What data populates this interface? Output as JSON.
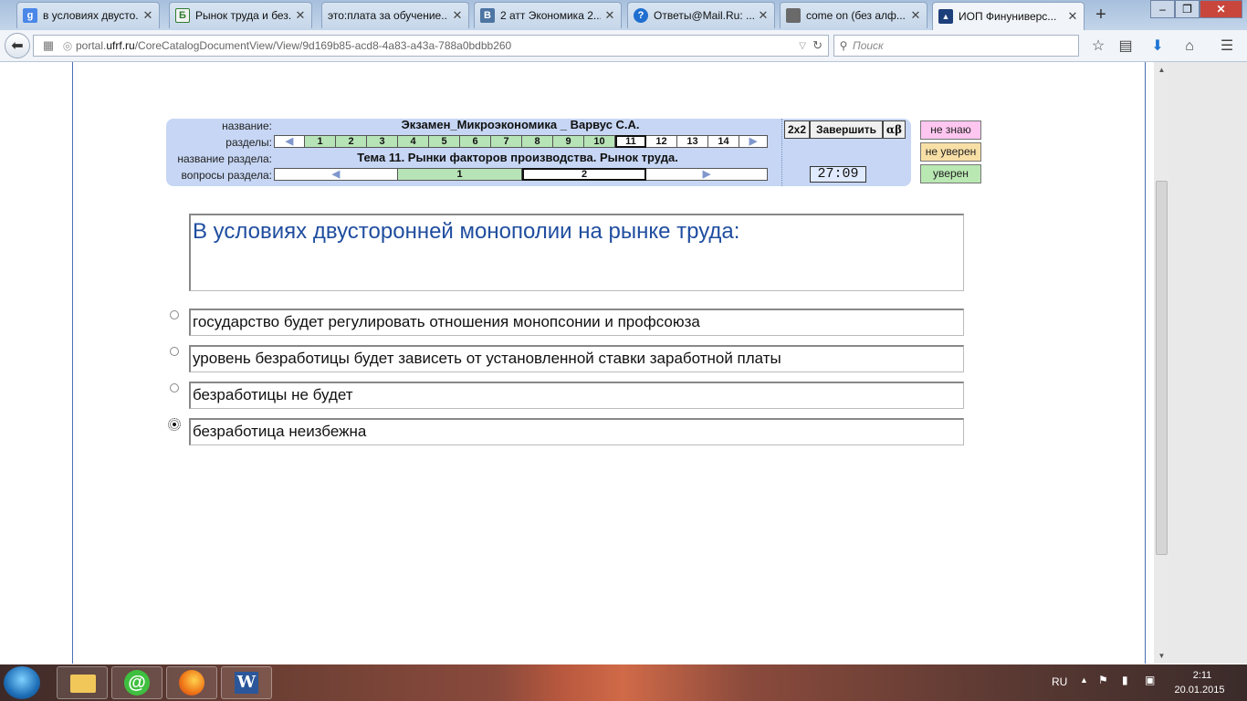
{
  "browser": {
    "tabs": [
      {
        "title": "в условиях двусто...",
        "icon": "google-icon",
        "color": "#4a87e8",
        "glyph": "g"
      },
      {
        "title": "Рынок труда и без...",
        "icon": "b-site-icon",
        "color": "#2f7d2f",
        "glyph": "Б"
      },
      {
        "title": "это:плата за обучение...",
        "icon": "generic-page-icon",
        "color": "#cfd8e3",
        "glyph": ""
      },
      {
        "title": "2 атт Экономика 2...",
        "icon": "vk-icon",
        "color": "#4c75a3",
        "glyph": "В"
      },
      {
        "title": "Ответы@Mail.Ru: ...",
        "icon": "mailru-answers-icon",
        "color": "#1f6fd0",
        "glyph": "?"
      },
      {
        "title": "come on (без алф...",
        "icon": "photo-icon",
        "color": "#6a6a6a",
        "glyph": ""
      },
      {
        "title": "ИОП Финуниверс...",
        "icon": "university-icon",
        "color": "#1d3f7a",
        "glyph": "▲"
      }
    ],
    "new_tab": "+",
    "url_prefix": "portal.",
    "url_domain": "ufrf.ru",
    "url_path": "/CoreCatalogDocumentView/View/9d169b85-acd8-4a83-a43a-788a0bdbb260",
    "search_placeholder": "Поиск"
  },
  "test": {
    "labels": {
      "name": "название:",
      "sections": "разделы:",
      "section_name": "название раздела:",
      "section_questions": "вопросы раздела:"
    },
    "name": "Экзамен_Микроэкономика _ Варвус С.А.",
    "sections": [
      "1",
      "2",
      "3",
      "4",
      "5",
      "6",
      "7",
      "8",
      "9",
      "10",
      "11",
      "12",
      "13",
      "14"
    ],
    "sections_completed_count": 10,
    "current_section": "11",
    "section_name": "Тема 11. Рынки факторов производства. Рынок труда.",
    "questions": [
      "1",
      "2"
    ],
    "current_question": "2",
    "buttons": {
      "size": "2x2",
      "finish": "Завершить",
      "alpha_beta": "αβ"
    },
    "timer": "27:09",
    "confidence": [
      {
        "label": "не знаю",
        "color": "#ffc6f0"
      },
      {
        "label": "не уверен",
        "color": "#f8dfa6"
      },
      {
        "label": "уверен",
        "color": "#b9e8b2"
      }
    ]
  },
  "question": {
    "text": "В условиях двусторонней монополии на рынке труда:",
    "answers": [
      {
        "text": "государство будет регулировать отношения монопсонии и профсоюза",
        "selected": false
      },
      {
        "text": "уровень безработицы будет зависеть от установленной ставки заработной платы",
        "selected": false
      },
      {
        "text": "безработицы не будет",
        "selected": false
      },
      {
        "text": "безработица неизбежна",
        "selected": true
      }
    ]
  },
  "taskbar": {
    "apps": [
      "file-explorer-icon",
      "mail-agent-icon",
      "firefox-icon",
      "word-icon"
    ],
    "language": "RU",
    "time": "2:11",
    "date": "20.01.2015"
  }
}
